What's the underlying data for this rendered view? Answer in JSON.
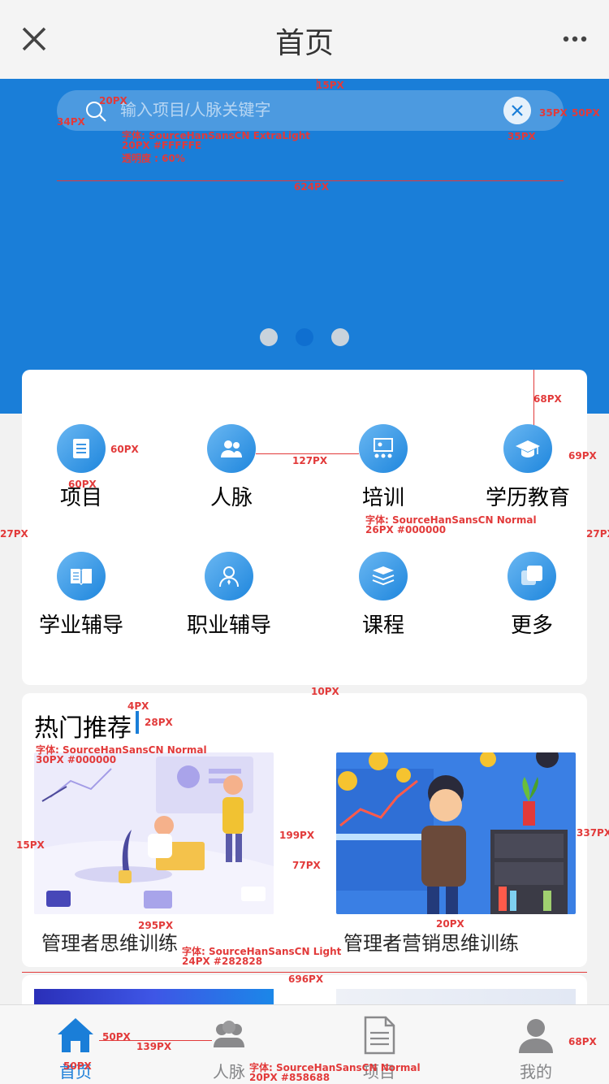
{
  "header": {
    "title": "首页"
  },
  "search": {
    "placeholder": "输入项目/人脉关键字"
  },
  "banner": {
    "dots": 3,
    "active_dot": 2
  },
  "categories": [
    {
      "label": "项目",
      "icon": "list-icon"
    },
    {
      "label": "人脉",
      "icon": "people-icon"
    },
    {
      "label": "培训",
      "icon": "training-icon"
    },
    {
      "label": "学历教育",
      "icon": "graduation-cap-icon"
    },
    {
      "label": "学业辅导",
      "icon": "book-icon"
    },
    {
      "label": "职业辅导",
      "icon": "career-person-icon"
    },
    {
      "label": "课程",
      "icon": "stack-books-icon"
    },
    {
      "label": "更多",
      "icon": "more-squares-icon"
    }
  ],
  "hot": {
    "title": "热门推荐",
    "items": [
      {
        "caption": "管理者思维训练"
      },
      {
        "caption": "管理者营销思维训练"
      }
    ]
  },
  "tabbar": [
    {
      "label": "首页",
      "active": true,
      "icon": "home-icon"
    },
    {
      "label": "人脉",
      "active": false,
      "icon": "contacts-icon"
    },
    {
      "label": "项目",
      "active": false,
      "icon": "document-icon"
    },
    {
      "label": "我的",
      "active": false,
      "icon": "profile-icon"
    }
  ],
  "annotations": {
    "a15": "15PX",
    "a20": "20PX",
    "a34": "34PX",
    "search_font": "字体: SourceHanSansCN ExtraLight",
    "search_font2": "20PX #FFFFFE",
    "search_font3": "透明度 : 60%",
    "a35a": "35PX",
    "a35b": "35PX",
    "a50": "50PX",
    "a624": "624PX",
    "a68": "68PX",
    "a60a": "60PX",
    "a60b": "60PX",
    "a127": "127PX",
    "a69": "69PX",
    "a27l": "27PX",
    "a27r": "27PX",
    "cat_font": "字体: SourceHanSansCN Normal",
    "cat_font2": "26PX #000000",
    "a10": "10PX",
    "a4": "4PX",
    "a28": "28PX",
    "hot_font": "字体: SourceHanSansCN Normal",
    "hot_font2": "30PX #000000",
    "a15b": "15PX",
    "a199": "199PX",
    "a77": "77PX",
    "a337": "337PX",
    "a295": "295PX",
    "a20b": "20PX",
    "cap_font": "字体: SourceHanSansCN Light",
    "cap_font2": "24PX #282828",
    "a696": "696PX",
    "a50t": "50PX",
    "a139": "139PX",
    "a50b": "50PX",
    "tab_font": "字体: SourceHanSansCN Normal",
    "tab_font2": "20PX #858688",
    "a68t": "68PX"
  },
  "colors": {
    "primary": "#1a7ed8",
    "annotation": "#e23a3a"
  }
}
